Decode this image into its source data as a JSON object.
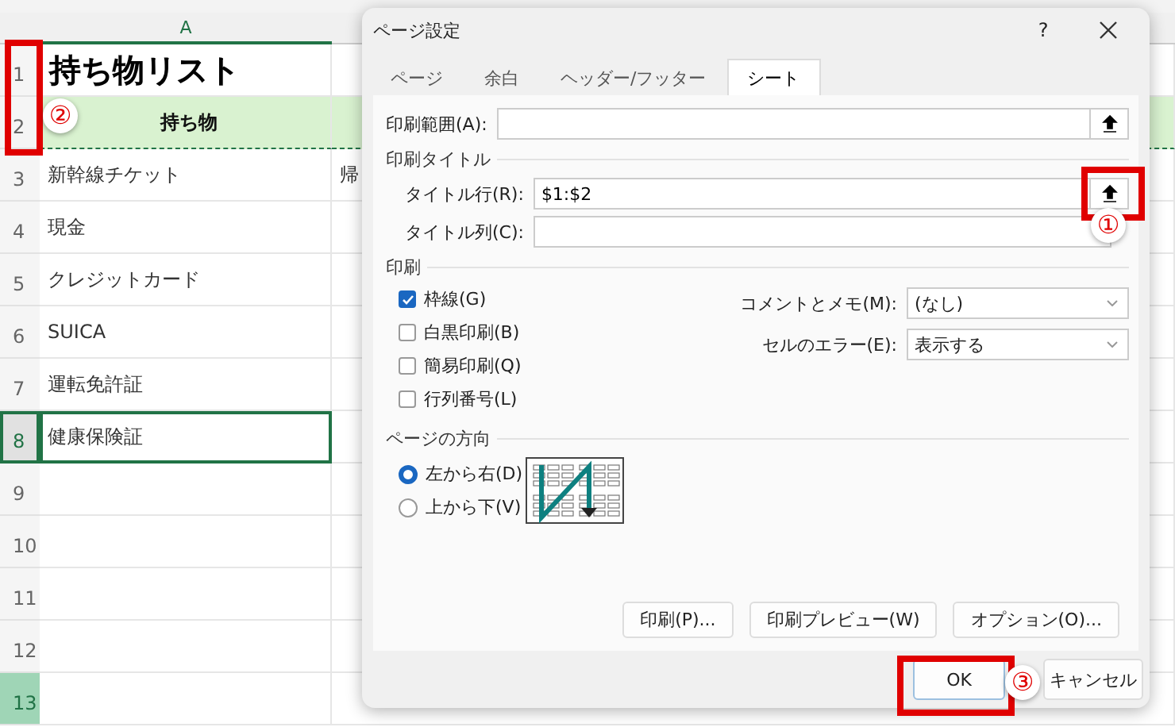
{
  "sheet": {
    "column_header": "A",
    "callout": "②",
    "rows": [
      {
        "number": "1",
        "kind": "title",
        "selected": false,
        "marked": false,
        "cells": [
          "持ち物リスト"
        ]
      },
      {
        "number": "2",
        "kind": "header",
        "selected": false,
        "marked": false,
        "cells": [
          "持ち物"
        ]
      },
      {
        "number": "3",
        "kind": "item",
        "selected": false,
        "marked": false,
        "cells": [
          "新幹線チケット",
          "帰"
        ]
      },
      {
        "number": "4",
        "kind": "item",
        "selected": false,
        "marked": false,
        "cells": [
          "現金"
        ]
      },
      {
        "number": "5",
        "kind": "item",
        "selected": false,
        "marked": false,
        "cells": [
          "クレジットカード"
        ]
      },
      {
        "number": "6",
        "kind": "item",
        "selected": false,
        "marked": false,
        "cells": [
          "SUICA"
        ]
      },
      {
        "number": "7",
        "kind": "item",
        "selected": false,
        "marked": false,
        "cells": [
          "運転免許証"
        ]
      },
      {
        "number": "8",
        "kind": "item",
        "selected": true,
        "marked": false,
        "cells": [
          "健康保険証"
        ]
      },
      {
        "number": "9",
        "kind": "item",
        "selected": false,
        "marked": false
      },
      {
        "number": "10",
        "kind": "item",
        "selected": false,
        "marked": false
      },
      {
        "number": "11",
        "kind": "item",
        "selected": false,
        "marked": false
      },
      {
        "number": "12",
        "kind": "item",
        "selected": false,
        "marked": false
      },
      {
        "number": "13",
        "kind": "item",
        "selected": false,
        "marked": true
      }
    ]
  },
  "dialog": {
    "title": "ページ設定",
    "help": "?",
    "tabs": [
      {
        "label": "ページ",
        "selected": false
      },
      {
        "label": "余白",
        "selected": false
      },
      {
        "label": "ヘッダー/フッター",
        "selected": false
      },
      {
        "label": "シート",
        "selected": true
      }
    ],
    "print_area": {
      "label": "印刷範囲(A):"
    },
    "print_titles": {
      "heading": "印刷タイトル",
      "rows_field": {
        "label": "タイトル行(R):",
        "value": "$1:$2",
        "callout": "①"
      },
      "columns_field": {
        "label": "タイトル列(C):"
      }
    },
    "print": {
      "heading": "印刷",
      "options": [
        {
          "label": "枠線(G)",
          "checked": true
        },
        {
          "label": "白黒印刷(B)",
          "checked": false
        },
        {
          "label": "簡易印刷(Q)",
          "checked": false
        },
        {
          "label": "行列番号(L)",
          "checked": false
        }
      ],
      "comments": {
        "label": "コメントとメモ(M):",
        "value": "(なし)"
      },
      "errors": {
        "label": "セルのエラー(E):",
        "value": "表示する"
      }
    },
    "page_order": {
      "heading": "ページの方向",
      "options": [
        {
          "label": "左から右(D)",
          "selected": true
        },
        {
          "label": "上から下(V)",
          "selected": false
        }
      ]
    },
    "buttons": [
      "印刷(P)...",
      "印刷プレビュー(W)",
      "オプション(O)..."
    ],
    "footer": {
      "ok": {
        "label": "OK",
        "callout": "③"
      },
      "cancel": {
        "label": "キャンセル"
      }
    }
  }
}
